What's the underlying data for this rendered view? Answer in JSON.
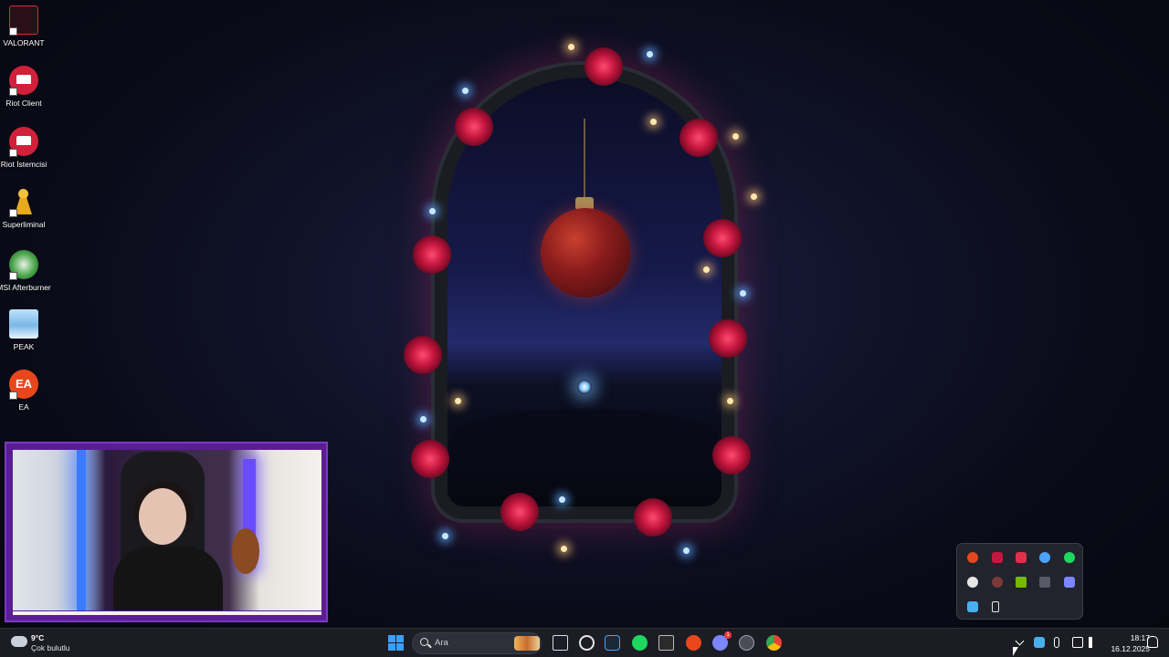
{
  "desktop": {
    "icons": [
      {
        "label": "VALORANT",
        "icon": "valorant-icon"
      },
      {
        "label": "Riot Client",
        "icon": "riot-client-icon"
      },
      {
        "label": "Riot İstemcisi",
        "icon": "riot-client-icon"
      },
      {
        "label": "Superliminal",
        "icon": "chess-pawn-icon"
      },
      {
        "label": "MSI Afterburner",
        "icon": "msi-afterburner-icon"
      },
      {
        "label": "PEAK",
        "icon": "peak-icon"
      },
      {
        "label": "EA",
        "icon": "ea-icon"
      }
    ]
  },
  "taskbar": {
    "weather": {
      "temp": "9°C",
      "desc": "Çok bulutlu",
      "icon": "partly-cloudy-icon"
    },
    "search": {
      "placeholder": "Ara"
    },
    "apps": [
      {
        "name": "task-view",
        "icon": "task-view-icon",
        "color": "#d8dce4"
      },
      {
        "name": "steelseries",
        "icon": "steelseries-icon",
        "color": "#e6e6e6"
      },
      {
        "name": "steam",
        "icon": "steam-icon",
        "color": "#4aa3ff"
      },
      {
        "name": "spotify",
        "icon": "spotify-icon",
        "color": "#1ed760"
      },
      {
        "name": "epic-games",
        "icon": "epic-games-icon",
        "color": "#2a2a2a"
      },
      {
        "name": "ea-app",
        "icon": "ea-app-icon",
        "color": "#e8471c"
      },
      {
        "name": "discord",
        "icon": "discord-icon",
        "color": "#7b86ff",
        "badge": "1"
      },
      {
        "name": "obs",
        "icon": "obs-icon",
        "color": "#9aa0aa"
      },
      {
        "name": "chrome",
        "icon": "chrome-icon",
        "color": "#f0c030"
      }
    ],
    "clock": {
      "time": "18:17",
      "date": "16.12.2025"
    }
  },
  "tray_popup": {
    "icons": [
      "ea-icon",
      "mic-icon",
      "riot-icon",
      "steam-icon",
      "spotify-icon",
      "steelseries-icon",
      "openrgb-icon",
      "nvidia-icon",
      "epic-games-icon",
      "discord-icon",
      "msi-afterburner-icon",
      "usb-device-icon"
    ]
  },
  "colors": {
    "taskbar_bg": "#1c1d24",
    "webcam_frame": "#5a1d94",
    "accent_blue": "#3aa0ff"
  }
}
